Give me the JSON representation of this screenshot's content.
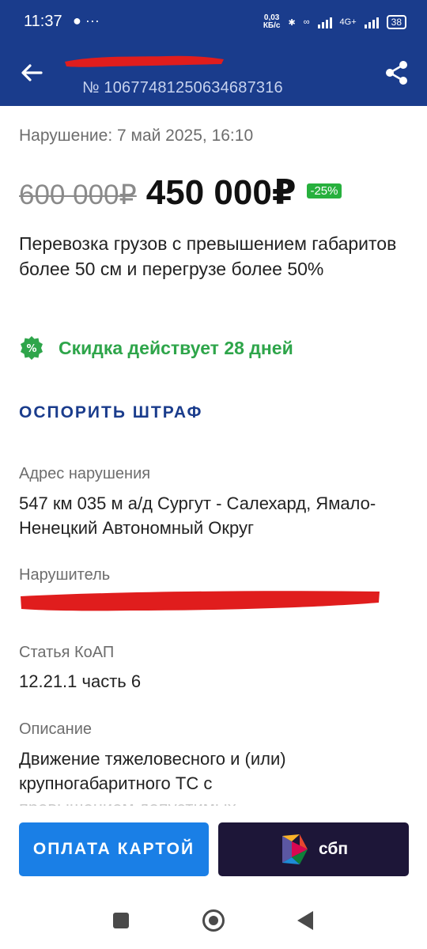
{
  "status_bar": {
    "time": "11:37",
    "notification_icons": "● ···",
    "speed_value": "0,03",
    "speed_unit": "КБ/с",
    "network_label": "4G+",
    "battery": "38"
  },
  "header": {
    "order_number": "№ 10677481250634687316"
  },
  "fine": {
    "violation_date": "Нарушение: 7 май 2025, 16:10",
    "old_price": "600 000₽",
    "new_price": "450 000₽",
    "discount_badge": "-25%",
    "title": "Перевозка грузов с превышением габаритов более 50 см и перегрузе более 50%",
    "discount_text": "Скидка действует 28 дней",
    "dispute_label": "ОСПОРИТЬ ШТРАФ"
  },
  "details": {
    "address_label": "Адрес нарушения",
    "address_value": "547 км 035 м а/д Сургут - Салехард, Ямало-Ненецкий Автономный Округ",
    "violator_label": "Нарушитель",
    "article_label": "Статья КоАП",
    "article_value": "12.21.1 часть 6",
    "description_label": "Описание",
    "description_value": "Движение тяжеловесного и (или) крупногабаритного ТС с превышением допустимых"
  },
  "buttons": {
    "pay_card": "ОПЛАТА КАРТОЙ",
    "sbp": "сбп"
  },
  "colors": {
    "brand": "#1a3c8c",
    "discount_green": "#2ea54a",
    "pay_button": "#1a7fe6",
    "sbp_button": "#1d1638",
    "redaction_red": "#e01d1d"
  }
}
